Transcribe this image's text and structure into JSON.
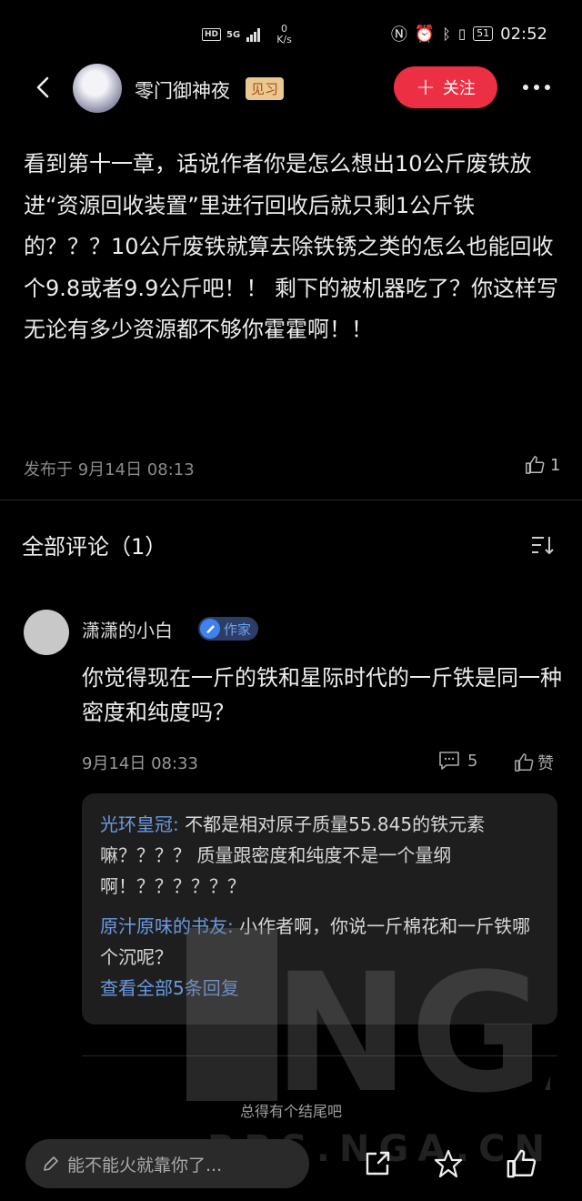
{
  "status_bar": {
    "hd": "HD",
    "signal": "5G",
    "net_speed_value": "0",
    "net_speed_unit": "K/s",
    "battery": "51",
    "time": "02:52"
  },
  "header": {
    "author": "零门御神夜",
    "level": "见习",
    "follow_label": "关注",
    "follow_color": "#ec2f43"
  },
  "post": {
    "body": "看到第十一章，话说作者你是怎么想出10公斤废铁放进“资源回收装置”里进行回收后就只剩1公斤铁的？？？10公斤废铁就算去除铁锈之类的怎么也能回收个9.8或者9.9公斤吧！！ 剩下的被机器吃了？你这样写无论有多少资源都不够你霍霍啊！！",
    "published": "发布于 9月14日 08:13",
    "like_count": "1"
  },
  "comments_section": {
    "title": "全部评论（1）",
    "comments": [
      {
        "name": "潇潇的小白",
        "badge": "作家",
        "text": "你觉得现在一斤的铁和星际时代的一斤铁是同一种密度和纯度吗？",
        "time": "9月14日 08:33",
        "reply_count": "5",
        "like_label": "赞",
        "replies": [
          {
            "user": "光环皇冠:",
            "text": " 不都是相对原子质量55.845的铁元素嘛？？？？ 质量跟密度和纯度不是一个量纲啊！？？？？？？"
          },
          {
            "user": "原汁原味的书友:",
            "text": " 小作者啊，你说一斤棉花和一斤铁哪个沉呢？"
          }
        ],
        "view_all": "查看全部5条回复"
      }
    ],
    "footer": "总得有个结尾吧"
  },
  "watermark": {
    "logo": "NGA",
    "url": "BBS.NGA.CN"
  },
  "bottom_bar": {
    "input_placeholder": "能不能火就靠你了..."
  }
}
